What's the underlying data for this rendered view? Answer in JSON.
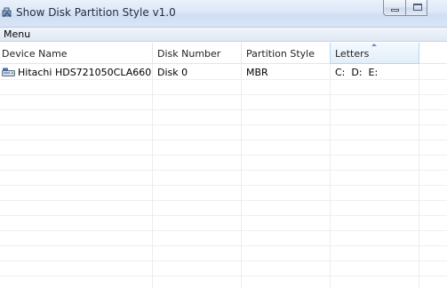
{
  "window": {
    "title": "Show Disk Partition Style v1.0"
  },
  "menubar": {
    "menu_label": "Menu"
  },
  "table": {
    "columns": [
      {
        "label": "Device Name"
      },
      {
        "label": "Disk Number"
      },
      {
        "label": "Partition Style"
      },
      {
        "label": "Letters",
        "sorted": true
      }
    ],
    "rows": [
      {
        "device_name": "Hitachi HDS721050CLA660",
        "disk_number": "Disk 0",
        "partition_style": "MBR",
        "letters": "C:  D:  E:",
        "icon": "hard-drive-icon"
      }
    ]
  },
  "colors": {
    "titlebar": "#dce8f7",
    "sorted_header": "#e2eefa",
    "gridline": "#ececec"
  }
}
